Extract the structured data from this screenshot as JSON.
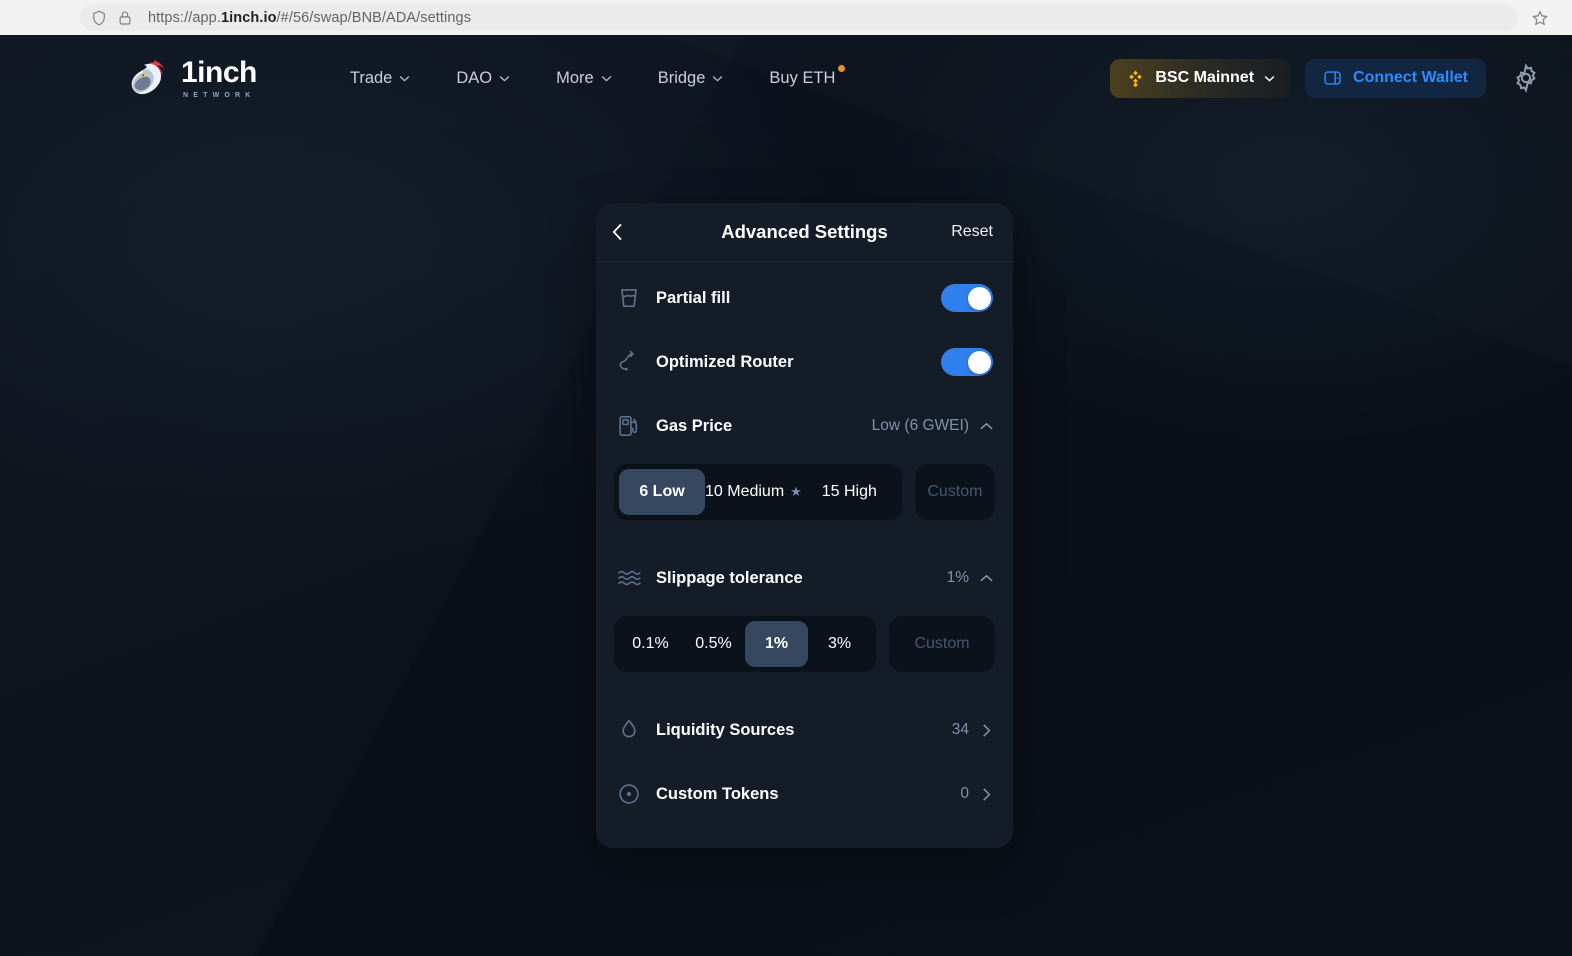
{
  "browser": {
    "url_prefix": "https://app.",
    "url_brand": "1inch.io",
    "url_suffix": "/#/56/swap/BNB/ADA/settings",
    "shield_icon": "shield-icon",
    "lock_icon": "lock-icon",
    "bookmark_icon": "star-icon"
  },
  "header": {
    "logo_word": "1inch",
    "logo_sub": "NETWORK",
    "nav": [
      {
        "label": "Trade",
        "has_caret": true,
        "badge": false
      },
      {
        "label": "DAO",
        "has_caret": true,
        "badge": false
      },
      {
        "label": "More",
        "has_caret": true,
        "badge": false
      },
      {
        "label": "Bridge",
        "has_caret": true,
        "badge": false
      },
      {
        "label": "Buy ETH",
        "has_caret": false,
        "badge": true
      }
    ],
    "network": {
      "label": "BSC Mainnet",
      "icon": "binance-icon",
      "accent": "#f0b90b"
    },
    "wallet": {
      "label": "Connect Wallet",
      "icon": "wallet-icon",
      "accent": "#2f8bfd"
    },
    "settings_icon": "gear-icon"
  },
  "panel": {
    "back_icon": "chevron-left-icon",
    "title": "Advanced Settings",
    "reset_label": "Reset",
    "partial_fill": {
      "label": "Partial fill",
      "icon": "glass-fill-icon",
      "enabled": true
    },
    "optimized_router": {
      "label": "Optimized Router",
      "icon": "route-icon",
      "enabled": true
    },
    "gas_price": {
      "label": "Gas Price",
      "icon": "fuel-pump-icon",
      "value": "Low (6 GWEI)",
      "collapse_icon": "chevron-up-icon",
      "options": [
        {
          "label": "6 Low",
          "starred": false,
          "selected": true
        },
        {
          "label": "10 Medium",
          "starred": true,
          "selected": false
        },
        {
          "label": "15 High",
          "starred": false,
          "selected": false
        }
      ],
      "custom_placeholder": "Custom",
      "custom_value": ""
    },
    "slippage": {
      "label": "Slippage tolerance",
      "icon": "waves-icon",
      "value": "1%",
      "collapse_icon": "chevron-up-icon",
      "options": [
        {
          "label": "0.1%",
          "selected": false
        },
        {
          "label": "0.5%",
          "selected": false
        },
        {
          "label": "1%",
          "selected": true
        },
        {
          "label": "3%",
          "selected": false
        }
      ],
      "custom_placeholder": "Custom",
      "custom_value": ""
    },
    "liquidity_sources": {
      "label": "Liquidity Sources",
      "icon": "droplet-icon",
      "value": "34",
      "chevron": "chevron-right-icon"
    },
    "custom_tokens": {
      "label": "Custom Tokens",
      "icon": "circle-dot-icon",
      "value": "0",
      "chevron": "chevron-right-icon"
    }
  },
  "colors": {
    "page_bg": "#0d1420",
    "panel_bg": "#141c28",
    "toggle_on": "#2f80ed",
    "segment_active": "#36485f",
    "segment_track": "#0c121c",
    "muted_text": "#7f92ad",
    "binance_yellow": "#f0b90b",
    "link_blue": "#2f8bfd",
    "badge_orange": "#e8922b"
  }
}
